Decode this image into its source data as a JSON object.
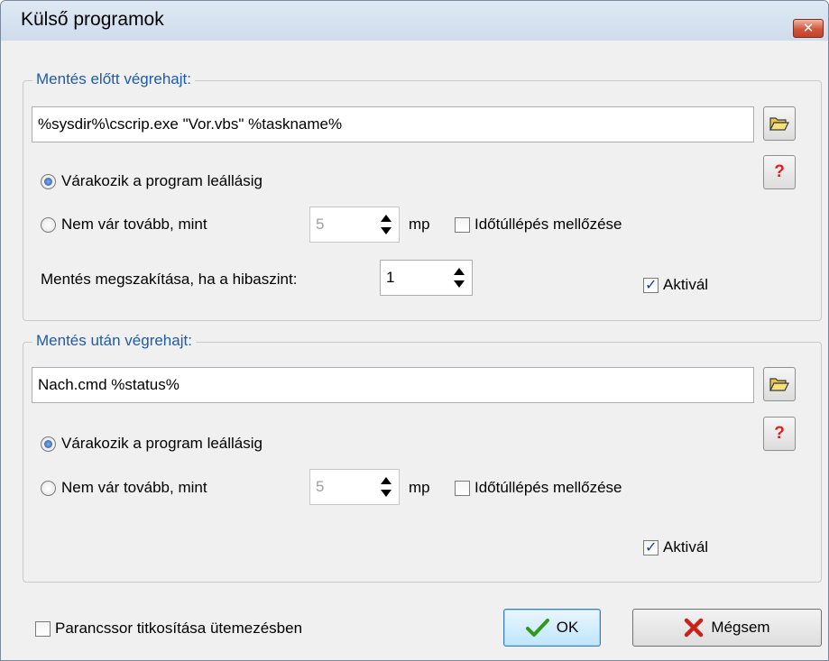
{
  "window": {
    "title": "Külső programok",
    "close_label": "✕"
  },
  "before": {
    "group_label": "Mentés előtt végrehajt:",
    "command_value": "%sysdir%\\cscrip.exe \"Vor.vbs\" %taskname%",
    "radio_wait_label": "Várakozik a program leállásig",
    "radio_wait_checked": true,
    "radio_timeout_label": "Nem vár tovább, mint",
    "timeout_value": "5",
    "timeout_unit": "mp",
    "ignore_timeout_label": "Időtúllépés mellőzése",
    "ignore_timeout_checked": false,
    "abort_label": "Mentés megszakítása, ha a hibaszint:",
    "abort_value": "1",
    "activate_label": "Aktivál",
    "activate_checked": true
  },
  "after": {
    "group_label": "Mentés után végrehajt:",
    "command_value": "Nach.cmd %status%",
    "radio_wait_label": "Várakozik a program leállásig",
    "radio_wait_checked": true,
    "radio_timeout_label": "Nem vár tovább, mint",
    "timeout_value": "5",
    "timeout_unit": "mp",
    "ignore_timeout_label": "Időtúllépés mellőzése",
    "ignore_timeout_checked": false,
    "activate_label": "Aktivál",
    "activate_checked": true
  },
  "icons": {
    "browse": "folder-open-icon",
    "help": "question-mark-icon",
    "ok": "checkmark-icon",
    "cancel": "x-icon"
  },
  "help_glyph": "?",
  "footer": {
    "encrypt_label": "Parancssor titkosítása ütemezésben",
    "encrypt_checked": false,
    "ok_label": "OK",
    "cancel_label": "Mégsem"
  },
  "colors": {
    "group_label": "#1f5ba6",
    "help_glyph": "#e02020",
    "ok_check": "#2f9a1c",
    "cancel_x": "#c8221a"
  }
}
